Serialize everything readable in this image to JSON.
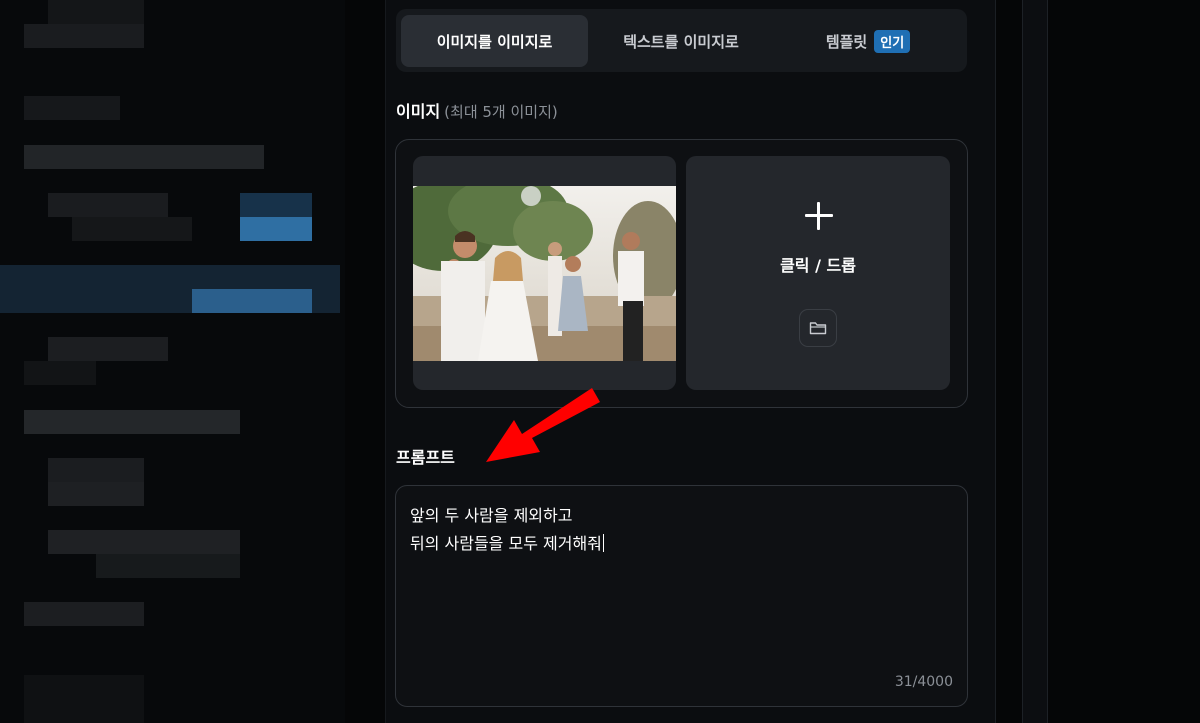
{
  "tabs": [
    {
      "label": "이미지를 이미지로",
      "active": true
    },
    {
      "label": "텍스트를 이미지로",
      "active": false
    },
    {
      "label": "템플릿",
      "active": false,
      "badge": "인기"
    }
  ],
  "image_section": {
    "label": "이미지",
    "hint": "(최대 5개 이미지)",
    "upload_text": "클릭 / 드롭",
    "upload_icon": "plus-icon",
    "folder_icon": "folder-icon"
  },
  "prompt_section": {
    "label": "프롬프트",
    "lines": [
      "앞의 두 사람을 제외하고",
      "뒤의 사람들을 모두 제거해줘"
    ],
    "counter": "31/4000"
  },
  "colors": {
    "background": "#0b0d10",
    "active_tab": "#2a2e34",
    "badge": "#1f6fb4",
    "annotation_arrow": "#ff0000"
  }
}
